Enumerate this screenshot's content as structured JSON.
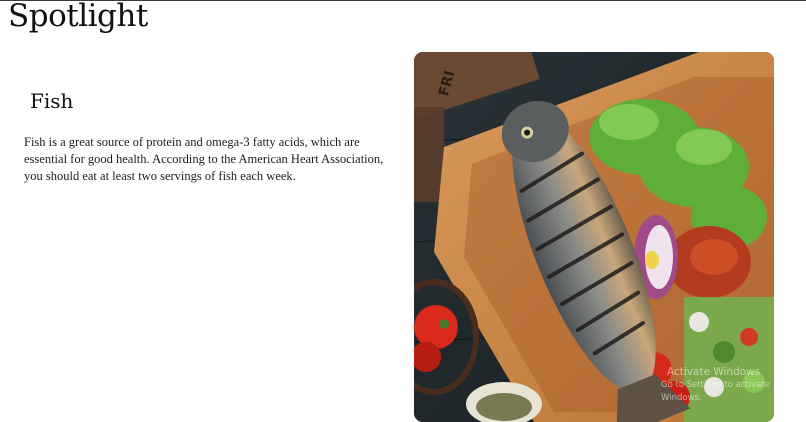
{
  "page": {
    "title": "Spotlight"
  },
  "spotlight": {
    "heading": "Fish",
    "description": "Fish is a great source of protein and omega-3 fatty acids, which are essential for good health. According to the American Heart Association, you should eat at least two servings of fish each week.",
    "image_alt": "Grilled fish on a wooden board with lettuce, onion, tomatoes and salad"
  },
  "watermark": {
    "line1": "Activate Windows",
    "line2": "Go to Settings to activate Windows."
  }
}
